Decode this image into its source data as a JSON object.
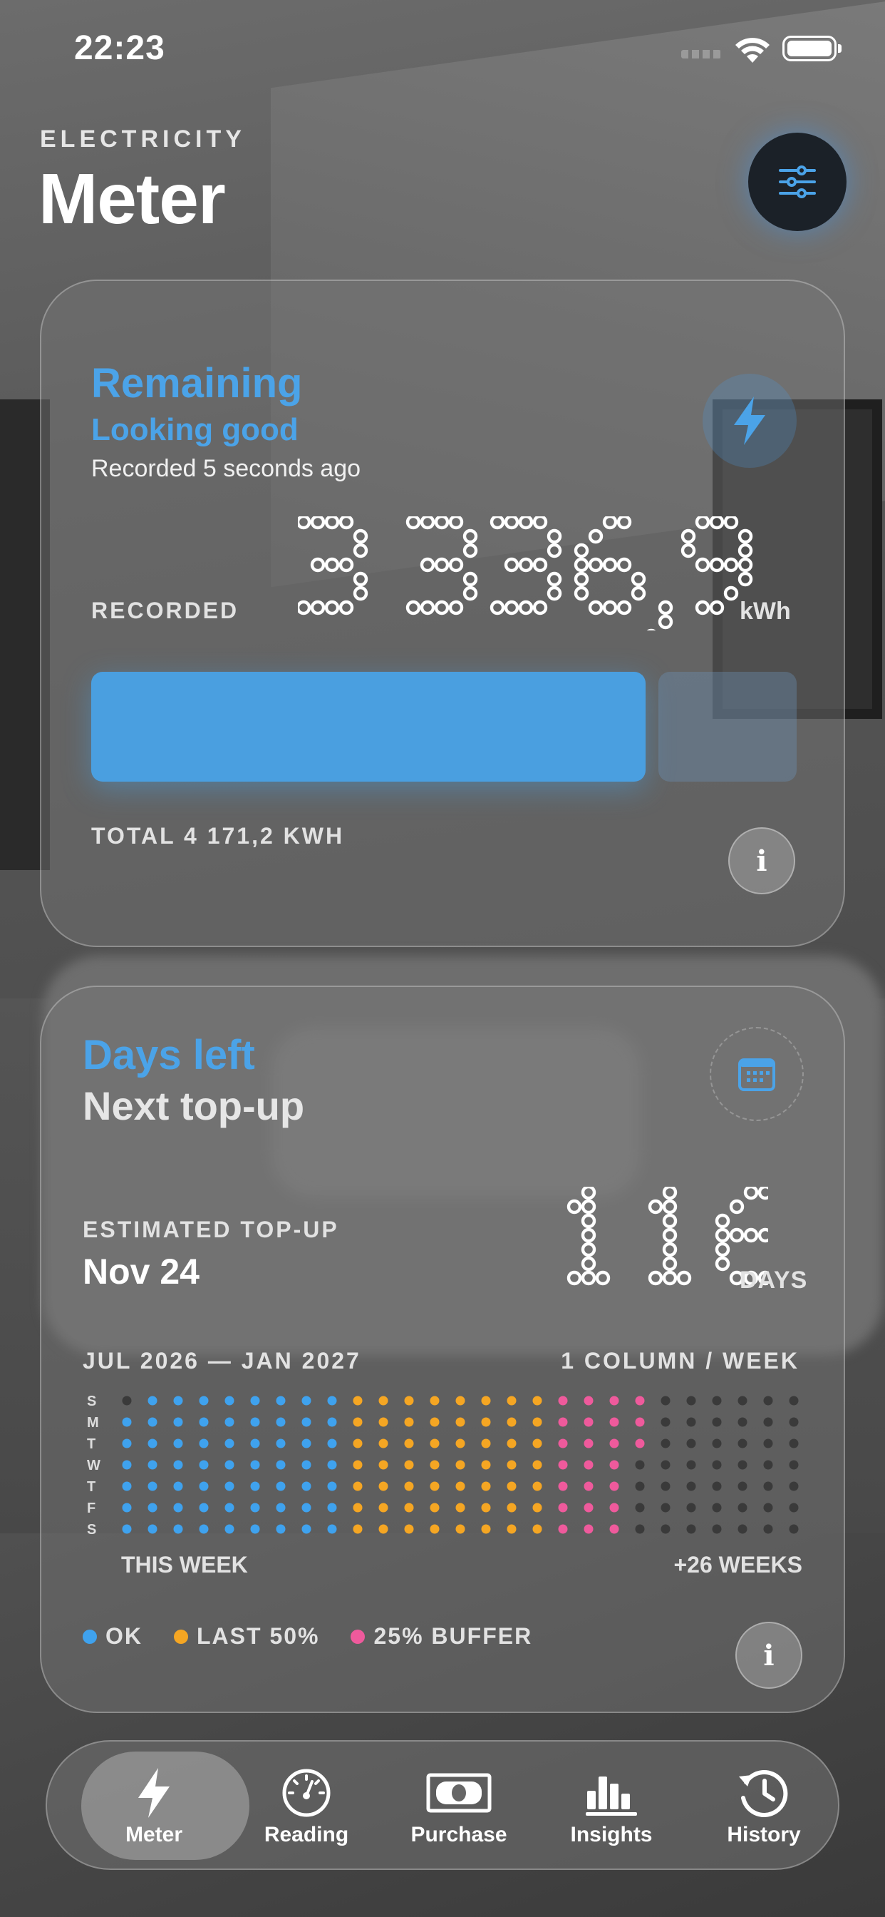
{
  "status_bar": {
    "time": "22:23"
  },
  "header": {
    "eyebrow": "ELECTRICITY",
    "title": "Meter"
  },
  "remaining_card": {
    "title": "Remaining",
    "status": "Looking good",
    "recorded_ago": "Recorded 5 seconds ago",
    "recorded_label": "RECORDED",
    "value": "3 336,9",
    "unit": "kWh",
    "total_label": "TOTAL 4 171,2 KWH",
    "fill_fraction": 0.8,
    "info_label": "i"
  },
  "days_card": {
    "title": "Days left",
    "subtitle": "Next top-up",
    "estimate_label": "ESTIMATED TOP-UP",
    "estimate_date": "Nov 24",
    "days_value": "116",
    "days_unit": "DAYS",
    "range": "JUL 2026 — JAN 2027",
    "column_note": "1 COLUMN / WEEK",
    "day_labels": [
      "S",
      "M",
      "T",
      "W",
      "T",
      "F",
      "S"
    ],
    "this_week": "THIS WEEK",
    "plus_weeks": "+26 WEEKS",
    "legend": [
      {
        "label": "OK",
        "color": "#3fa2ee"
      },
      {
        "label": "LAST 50%",
        "color": "#f5a623"
      },
      {
        "label": "25% BUFFER",
        "color": "#ef5a9c"
      }
    ],
    "weeks": 27,
    "ok_weeks": 9,
    "half_weeks": 8,
    "buffer_weeks": 4,
    "info_label": "i"
  },
  "tabs": [
    {
      "label": "Meter",
      "icon": "bolt-icon",
      "active": true
    },
    {
      "label": "Reading",
      "icon": "gauge-icon",
      "active": false
    },
    {
      "label": "Purchase",
      "icon": "banknote-icon",
      "active": false
    },
    {
      "label": "Insights",
      "icon": "bar-chart-icon",
      "active": false
    },
    {
      "label": "History",
      "icon": "history-icon",
      "active": false
    }
  ]
}
